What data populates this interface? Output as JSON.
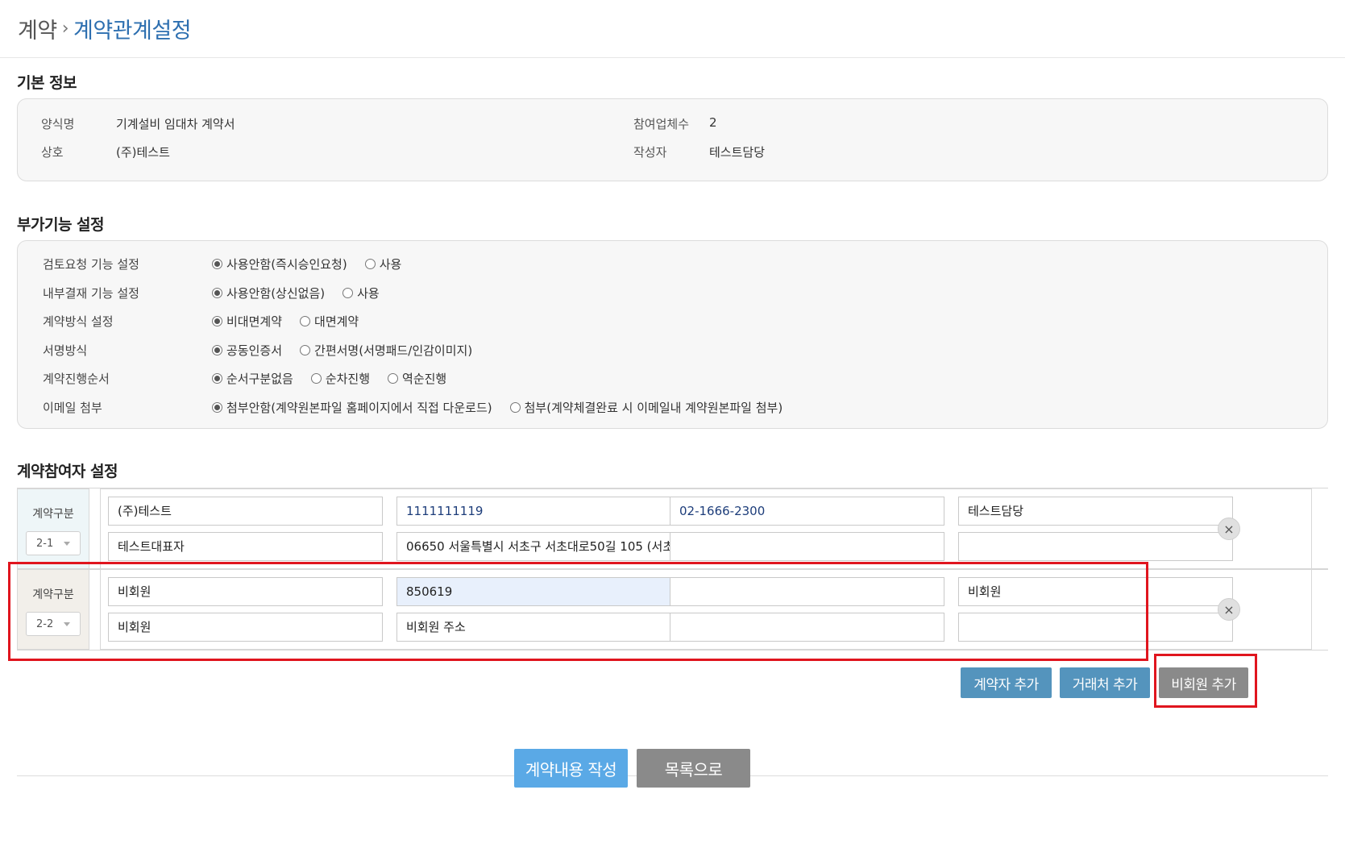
{
  "breadcrumb": {
    "parent": "계약",
    "separator": "›",
    "current": "계약관계설정"
  },
  "basic_info": {
    "title": "기본 정보",
    "form_name_label": "양식명",
    "form_name_value": "기계설비 임대차 계약서",
    "company_label": "상호",
    "company_value": "(주)테스트",
    "participants_label": "참여업체수",
    "participants_value": "2",
    "author_label": "작성자",
    "author_value": "테스트담당"
  },
  "options": {
    "title": "부가기능 설정",
    "rows": [
      {
        "label": "검토요청 기능 설정",
        "choices": [
          "사용안함(즉시승인요청)",
          "사용"
        ],
        "selected": 0
      },
      {
        "label": "내부결재 기능 설정",
        "choices": [
          "사용안함(상신없음)",
          "사용"
        ],
        "selected": 0
      },
      {
        "label": "계약방식 설정",
        "choices": [
          "비대면계약",
          "대면계약"
        ],
        "selected": 0
      },
      {
        "label": "서명방식",
        "choices": [
          "공동인증서",
          "간편서명(서명패드/인감이미지)"
        ],
        "selected": 0
      },
      {
        "label": "계약진행순서",
        "choices": [
          "순서구분없음",
          "순차진행",
          "역순진행"
        ],
        "selected": 0
      },
      {
        "label": "이메일 첨부",
        "choices": [
          "첨부안함(계약원본파일 홈페이지에서 직접 다운로드)",
          "첨부(계약체결완료 시 이메일내 계약원본파일 첨부)"
        ],
        "selected": 0
      }
    ]
  },
  "participants": {
    "title": "계약참여자 설정",
    "items": [
      {
        "type_label": "계약구분",
        "type_value": "2-1",
        "row1": [
          "(주)테스트",
          "1111111119",
          "02-1666-2300",
          "테스트담당"
        ],
        "row2": [
          "테스트대표자",
          "06650 서울특별시 서초구 서초대로50길 105 (서초",
          "",
          ""
        ]
      },
      {
        "type_label": "계약구분",
        "type_value": "2-2",
        "row1": [
          "비회원",
          "850619",
          "",
          "비회원"
        ],
        "row2": [
          "비회원",
          "비회원 주소",
          "",
          ""
        ]
      }
    ],
    "close_icon": "×"
  },
  "actions": {
    "add_contractor": "계약자 추가",
    "add_partner": "거래처 추가",
    "add_nonmember": "비회원 추가",
    "write_contract": "계약내용 작성",
    "to_list": "목록으로"
  },
  "colors": {
    "accent": "#2d6fb0",
    "highlight": "#e0151e",
    "teal_button": "#5494bd",
    "primary_button": "#5aa9e6",
    "gray_button": "#8a8a8a"
  }
}
